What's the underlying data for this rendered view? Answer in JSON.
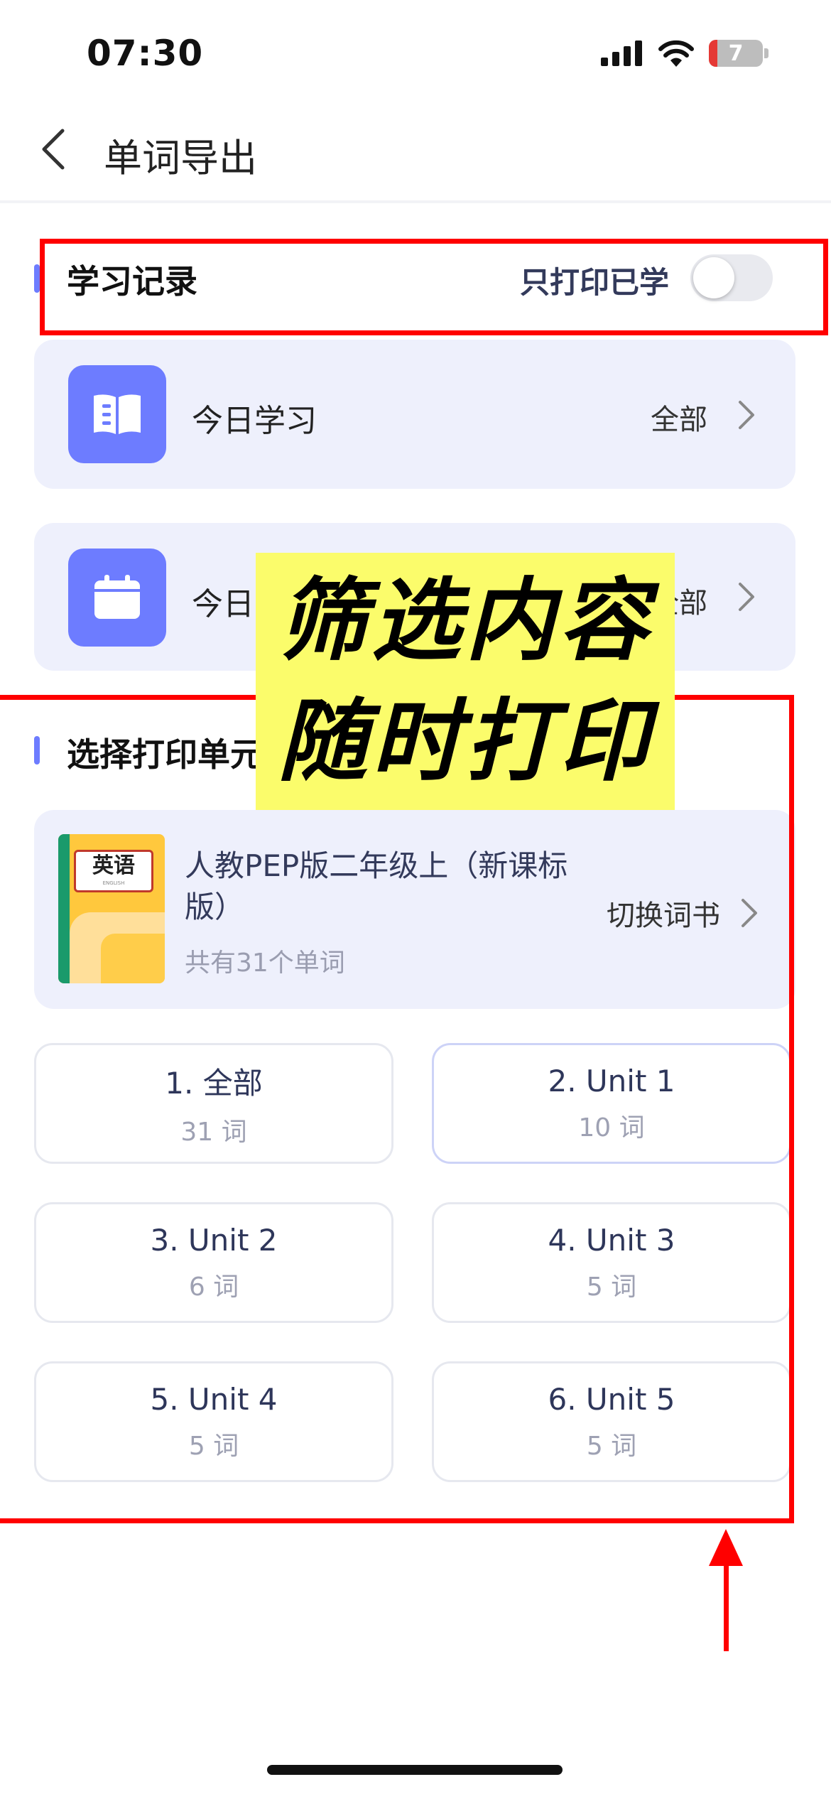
{
  "status_bar": {
    "time": "07:30",
    "battery": "7"
  },
  "nav": {
    "title": "单词导出"
  },
  "study_record": {
    "title": "学习记录",
    "toggle_label": "只打印已学",
    "toggle_on": false,
    "rows": [
      {
        "label": "今日学习",
        "right": "全部",
        "icon": "book-open-icon"
      },
      {
        "label": "今日",
        "right": "全部",
        "icon": "calendar-icon"
      }
    ]
  },
  "select_unit": {
    "title": "选择打印单元",
    "book": {
      "cover_text": "英语",
      "cover_subtext": "ENGLISH",
      "title": "人教PEP版二年级上（新课标版）",
      "count": "共有31个单词",
      "switch_label": "切换词书"
    },
    "units": [
      {
        "name": "1. 全部",
        "count": "31 词",
        "active": false
      },
      {
        "name": "2. Unit 1",
        "count": "10 词",
        "active": true
      },
      {
        "name": "3. Unit 2",
        "count": "6 词",
        "active": false
      },
      {
        "name": "4. Unit 3",
        "count": "5 词",
        "active": false
      },
      {
        "name": "5. Unit 4",
        "count": "5 词",
        "active": false
      },
      {
        "name": "6. Unit 5",
        "count": "5 词",
        "active": false
      }
    ]
  },
  "promo": {
    "line1": "筛选内容",
    "line2": "随时打印"
  },
  "colors": {
    "accent": "#6d7cff",
    "card_bg": "#eef0fc",
    "highlight_red": "#ff0000",
    "promo_yellow": "#fbfc6b"
  }
}
